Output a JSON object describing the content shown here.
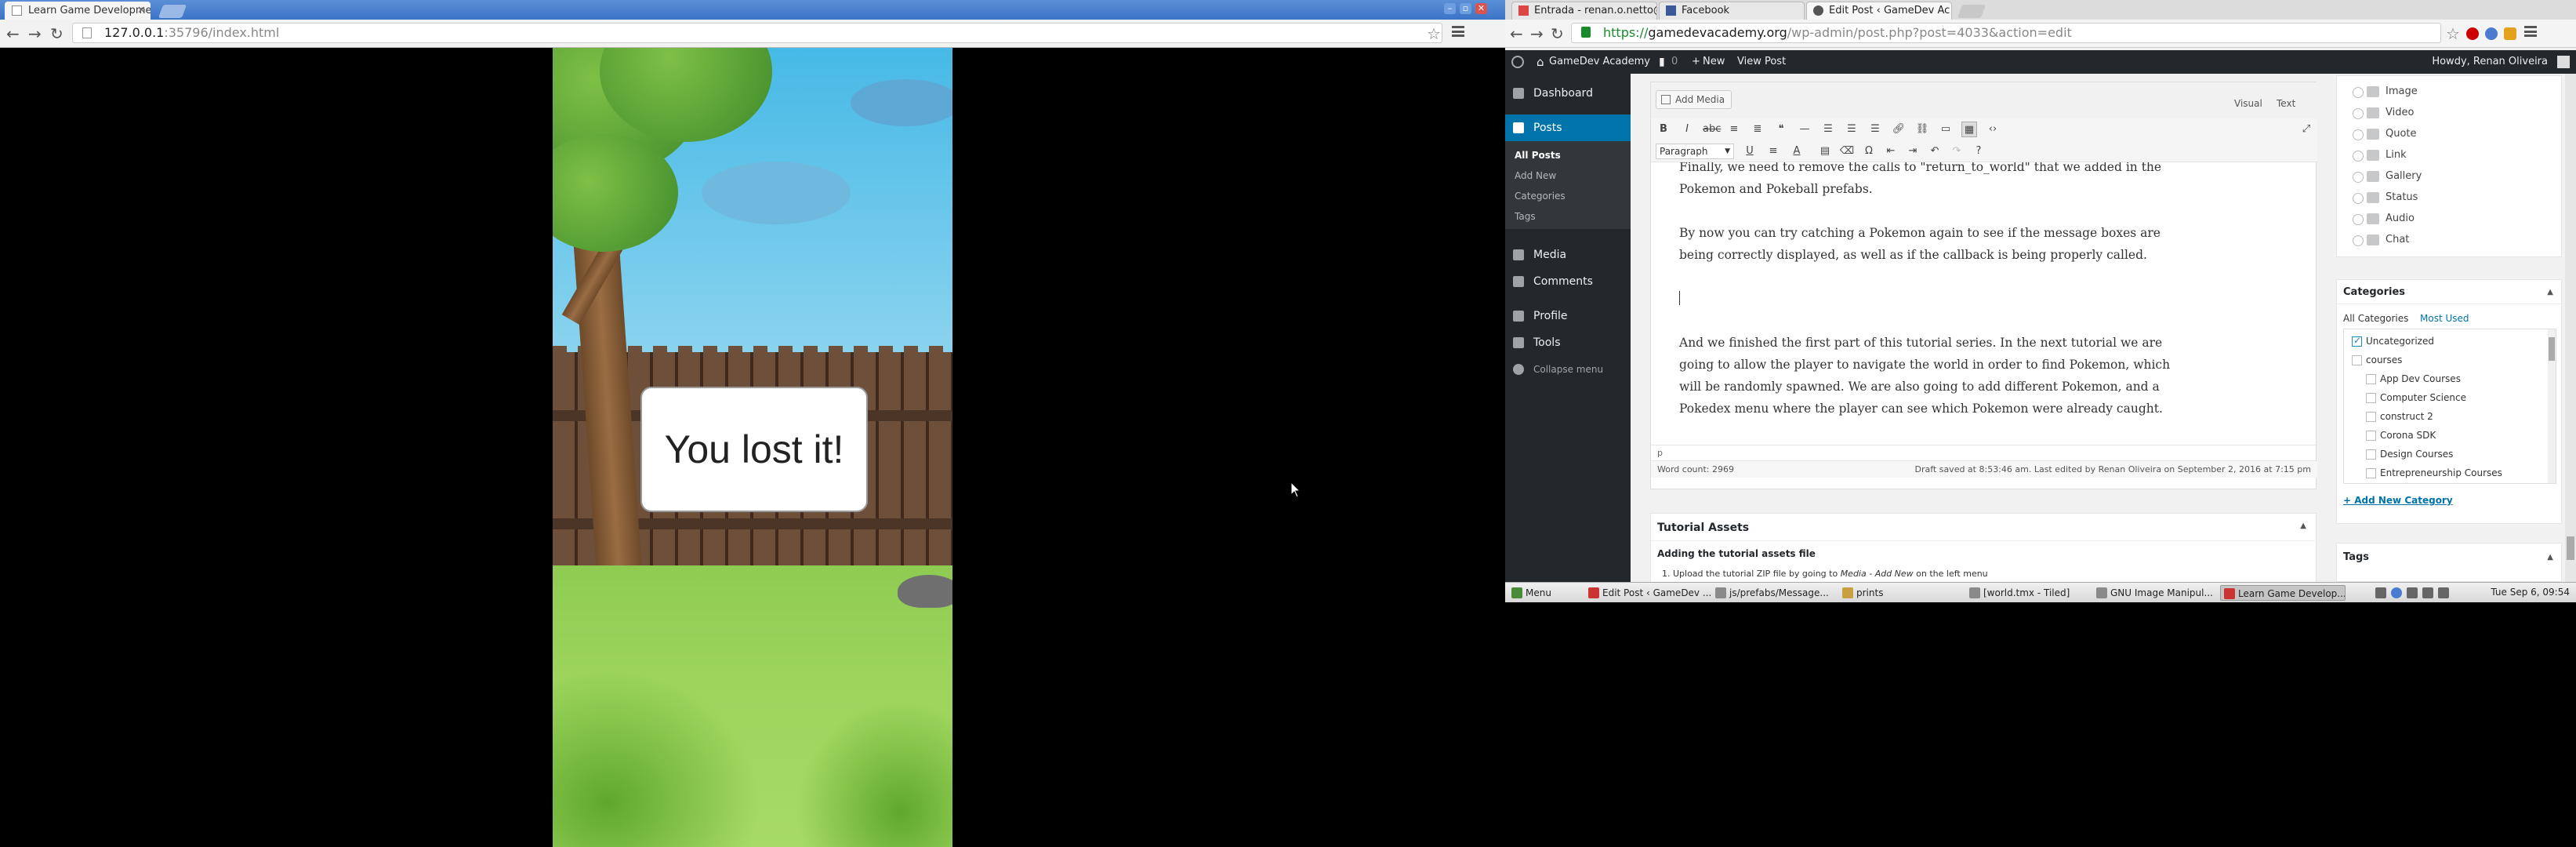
{
  "left_window": {
    "tab_title": "Learn Game Developme",
    "url_host": "127.0.0.1",
    "url_rest": ":35796/index.html",
    "game": {
      "message": "You lost it!"
    }
  },
  "right_window": {
    "tabs": [
      {
        "label": "Entrada - renan.o.netto@"
      },
      {
        "label": "Facebook"
      },
      {
        "label": "Edit Post ‹ GameDev Ac"
      }
    ],
    "url_scheme": "https://",
    "url_host": "gamedevacademy.org",
    "url_path": "/wp-admin/post.php?post=4033&action=edit",
    "adminbar": {
      "site": "GameDev Academy",
      "comments": "0",
      "new": "New",
      "view_post": "View Post",
      "howdy": "Howdy, Renan Oliveira"
    },
    "sidebar": {
      "dashboard": "Dashboard",
      "posts": "Posts",
      "sub": [
        "All Posts",
        "Add New",
        "Categories",
        "Tags"
      ],
      "media": "Media",
      "comments": "Comments",
      "profile": "Profile",
      "tools": "Tools",
      "collapse": "Collapse menu"
    },
    "editor": {
      "add_media": "Add Media",
      "tab_visual": "Visual",
      "tab_text": "Text",
      "paragraph_select": "Paragraph",
      "para1_line1": "Finally, we need to remove the calls to \"return_to_world\" that we added in the",
      "para1_line2": "Pokemon and Pokeball prefabs.",
      "para2_line1": "By now you can try catching a Pokemon again to see if the message boxes are",
      "para2_line2": "being correctly displayed, as well as if the callback is being properly called.",
      "para3_line1": "And we finished the first part of this tutorial series. In the next tutorial we are",
      "para3_line2": "going to allow the player to navigate the world in order to find Pokemon, which",
      "para3_line3": "will be randomly spawned. We are also going to add different Pokemon, and a",
      "para3_line4": "Pokedex menu where the player can see which Pokemon were already caught.",
      "path": "p",
      "word_count": "Word count: 2969",
      "draft_status": "Draft saved at 8:53:46 am. Last edited by Renan Oliveira on September 2, 2016 at 7:15 pm"
    },
    "tutorial_assets": {
      "title": "Tutorial Assets",
      "subtitle": "Adding the tutorial assets file",
      "step1_a": "1. Upload the tutorial ZIP file by going to ",
      "step1_em": "Media - Add New",
      "step1_b": " on the left menu"
    },
    "formats": [
      "Image",
      "Video",
      "Quote",
      "Link",
      "Gallery",
      "Status",
      "Audio",
      "Chat"
    ],
    "categories": {
      "title": "Categories",
      "tab_all": "All Categories",
      "tab_most": "Most Used",
      "items": [
        {
          "label": "Uncategorized",
          "checked": true
        },
        {
          "label": "courses",
          "checked": false
        },
        {
          "label": "App Dev Courses",
          "checked": false
        },
        {
          "label": "Computer Science",
          "checked": false
        },
        {
          "label": "construct 2",
          "checked": false
        },
        {
          "label": "Corona SDK",
          "checked": false
        },
        {
          "label": "Design Courses",
          "checked": false
        },
        {
          "label": "Entrepreneurship Courses",
          "checked": false
        }
      ],
      "add_new": "+ Add New Category"
    },
    "tags_title": "Tags",
    "taskbar": {
      "menu": "Menu",
      "items": [
        "Edit Post ‹ GameDev ...",
        "js/prefabs/Message...",
        "prints",
        "[world.tmx - Tiled]",
        "GNU Image Manipul...",
        "Learn Game Develop..."
      ],
      "clock": "Tue Sep 6, 09:54"
    }
  }
}
